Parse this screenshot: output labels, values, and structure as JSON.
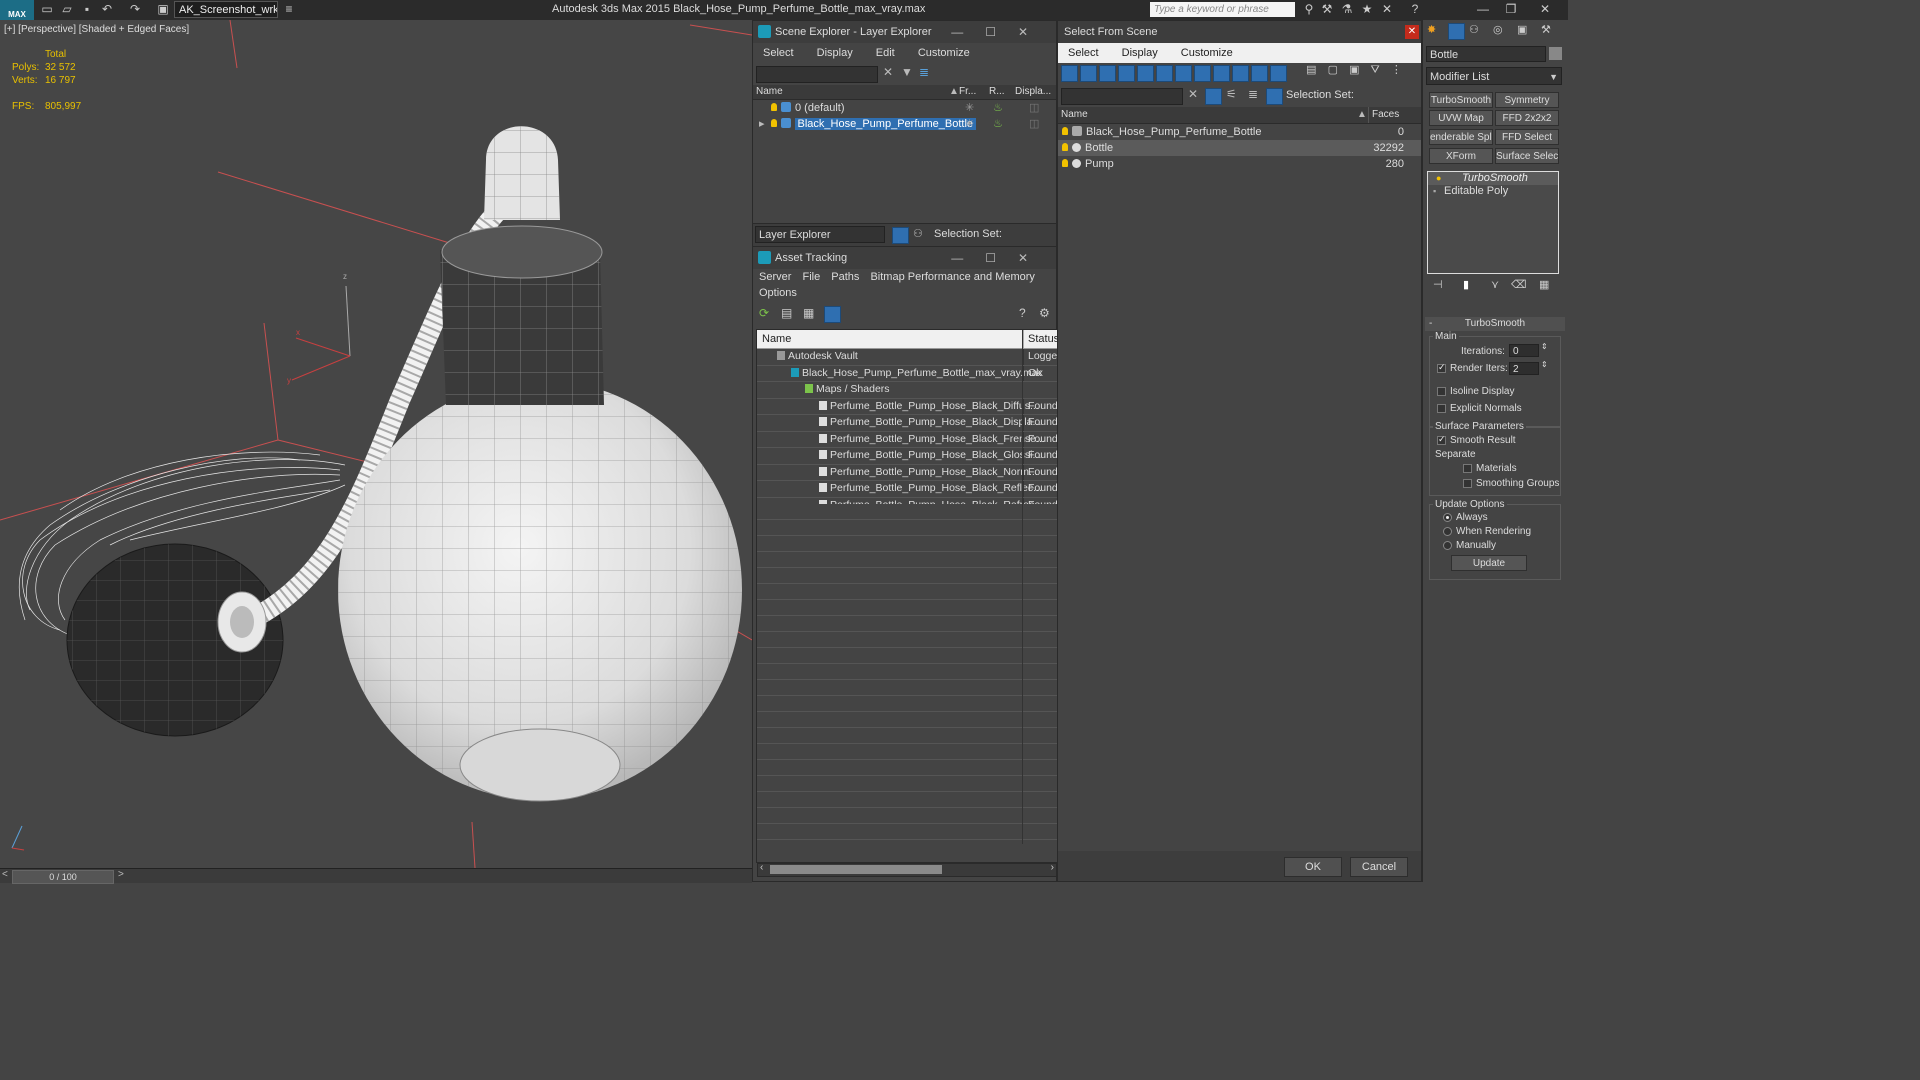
{
  "app": {
    "workspace": "AK_Screenshot_wrksp",
    "title": "Autodesk 3ds Max  2015     Black_Hose_Pump_Perfume_Bottle_max_vray.max",
    "search_placeholder": "Type a keyword or phrase",
    "logo_text": "MAX"
  },
  "viewport": {
    "label": "[+] [Perspective] [Shaded + Edged Faces]",
    "stats_total": "Total",
    "polys_label": "Polys:",
    "polys_value": "32 572",
    "verts_label": "Verts:",
    "verts_value": "16 797",
    "fps_label": "FPS:",
    "fps_value": "805,997",
    "axis_z": "z",
    "axis_x": "x",
    "axis_y": "y"
  },
  "timeline": {
    "frame": "0 / 100"
  },
  "scene_explorer": {
    "title": "Scene Explorer - Layer Explorer",
    "menus": [
      "Select",
      "Display",
      "Edit",
      "Customize"
    ],
    "columns": {
      "name": "Name",
      "frozen": "Fr...",
      "render": "R...",
      "display": "Displa..."
    },
    "rows": [
      {
        "label": "0 (default)"
      },
      {
        "label": "Black_Hose_Pump_Perfume_Bottle"
      }
    ],
    "footer_mode": "Layer Explorer",
    "footer_selset": "Selection Set:"
  },
  "asset_tracking": {
    "title": "Asset Tracking",
    "menus": [
      "Server",
      "File",
      "Paths",
      "Bitmap Performance and Memory"
    ],
    "menu_options": "Options",
    "col_name": "Name",
    "col_status": "Status",
    "rows": [
      {
        "name": "Autodesk Vault",
        "status": "Logged"
      },
      {
        "name": "Black_Hose_Pump_Perfume_Bottle_max_vray.max",
        "status": "Ok"
      },
      {
        "name": "Maps / Shaders",
        "status": ""
      },
      {
        "name": "Perfume_Bottle_Pump_Hose_Black_Diffus...",
        "status": "Found"
      },
      {
        "name": "Perfume_Bottle_Pump_Hose_Black_Displa...",
        "status": "Found"
      },
      {
        "name": "Perfume_Bottle_Pump_Hose_Black_Frense...",
        "status": "Found"
      },
      {
        "name": "Perfume_Bottle_Pump_Hose_Black_Glossi...",
        "status": "Found"
      },
      {
        "name": "Perfume_Bottle_Pump_Hose_Black_Norm...",
        "status": "Found"
      },
      {
        "name": "Perfume_Bottle_Pump_Hose_Black_Reflec...",
        "status": "Found"
      },
      {
        "name": "Perfume_Bottle_Pump_Hose_Black_Refrac...",
        "status": "Found"
      }
    ]
  },
  "select_from_scene": {
    "title": "Select From Scene",
    "menus": [
      "Select",
      "Display",
      "Customize"
    ],
    "selset": "Selection Set:",
    "col_name": "Name",
    "col_faces": "Faces",
    "rows": [
      {
        "name": "Black_Hose_Pump_Perfume_Bottle",
        "faces": "0"
      },
      {
        "name": "Bottle",
        "faces": "32292"
      },
      {
        "name": "Pump",
        "faces": "280"
      }
    ],
    "ok": "OK",
    "cancel": "Cancel"
  },
  "command_panel": {
    "object_name": "Bottle",
    "modifier_list": "Modifier List",
    "mod_buttons": [
      "TurboSmooth",
      "Symmetry",
      "UVW Map",
      "FFD 2x2x2",
      "enderable Splir",
      "FFD Select",
      "XForm",
      "Surface Select"
    ],
    "stack": [
      "TurboSmooth",
      "Editable Poly"
    ],
    "rollout": {
      "title": "TurboSmooth",
      "main": "Main",
      "iterations_label": "Iterations:",
      "iterations": "0",
      "render_iters_label": "Render Iters:",
      "render_iters": "2",
      "isoline": "Isoline Display",
      "explicit_normals": "Explicit Normals",
      "surface_params": "Surface Parameters",
      "smooth_result": "Smooth Result",
      "separate": "Separate",
      "materials": "Materials",
      "smoothing_groups": "Smoothing Groups",
      "update_options": "Update Options",
      "always": "Always",
      "when_rendering": "When Rendering",
      "manually": "Manually",
      "update": "Update"
    }
  },
  "colors": {
    "accent": "#1c9bb8",
    "selection": "#2f6fb1",
    "stats": "#e8c000",
    "close_red": "#c42b1c"
  }
}
